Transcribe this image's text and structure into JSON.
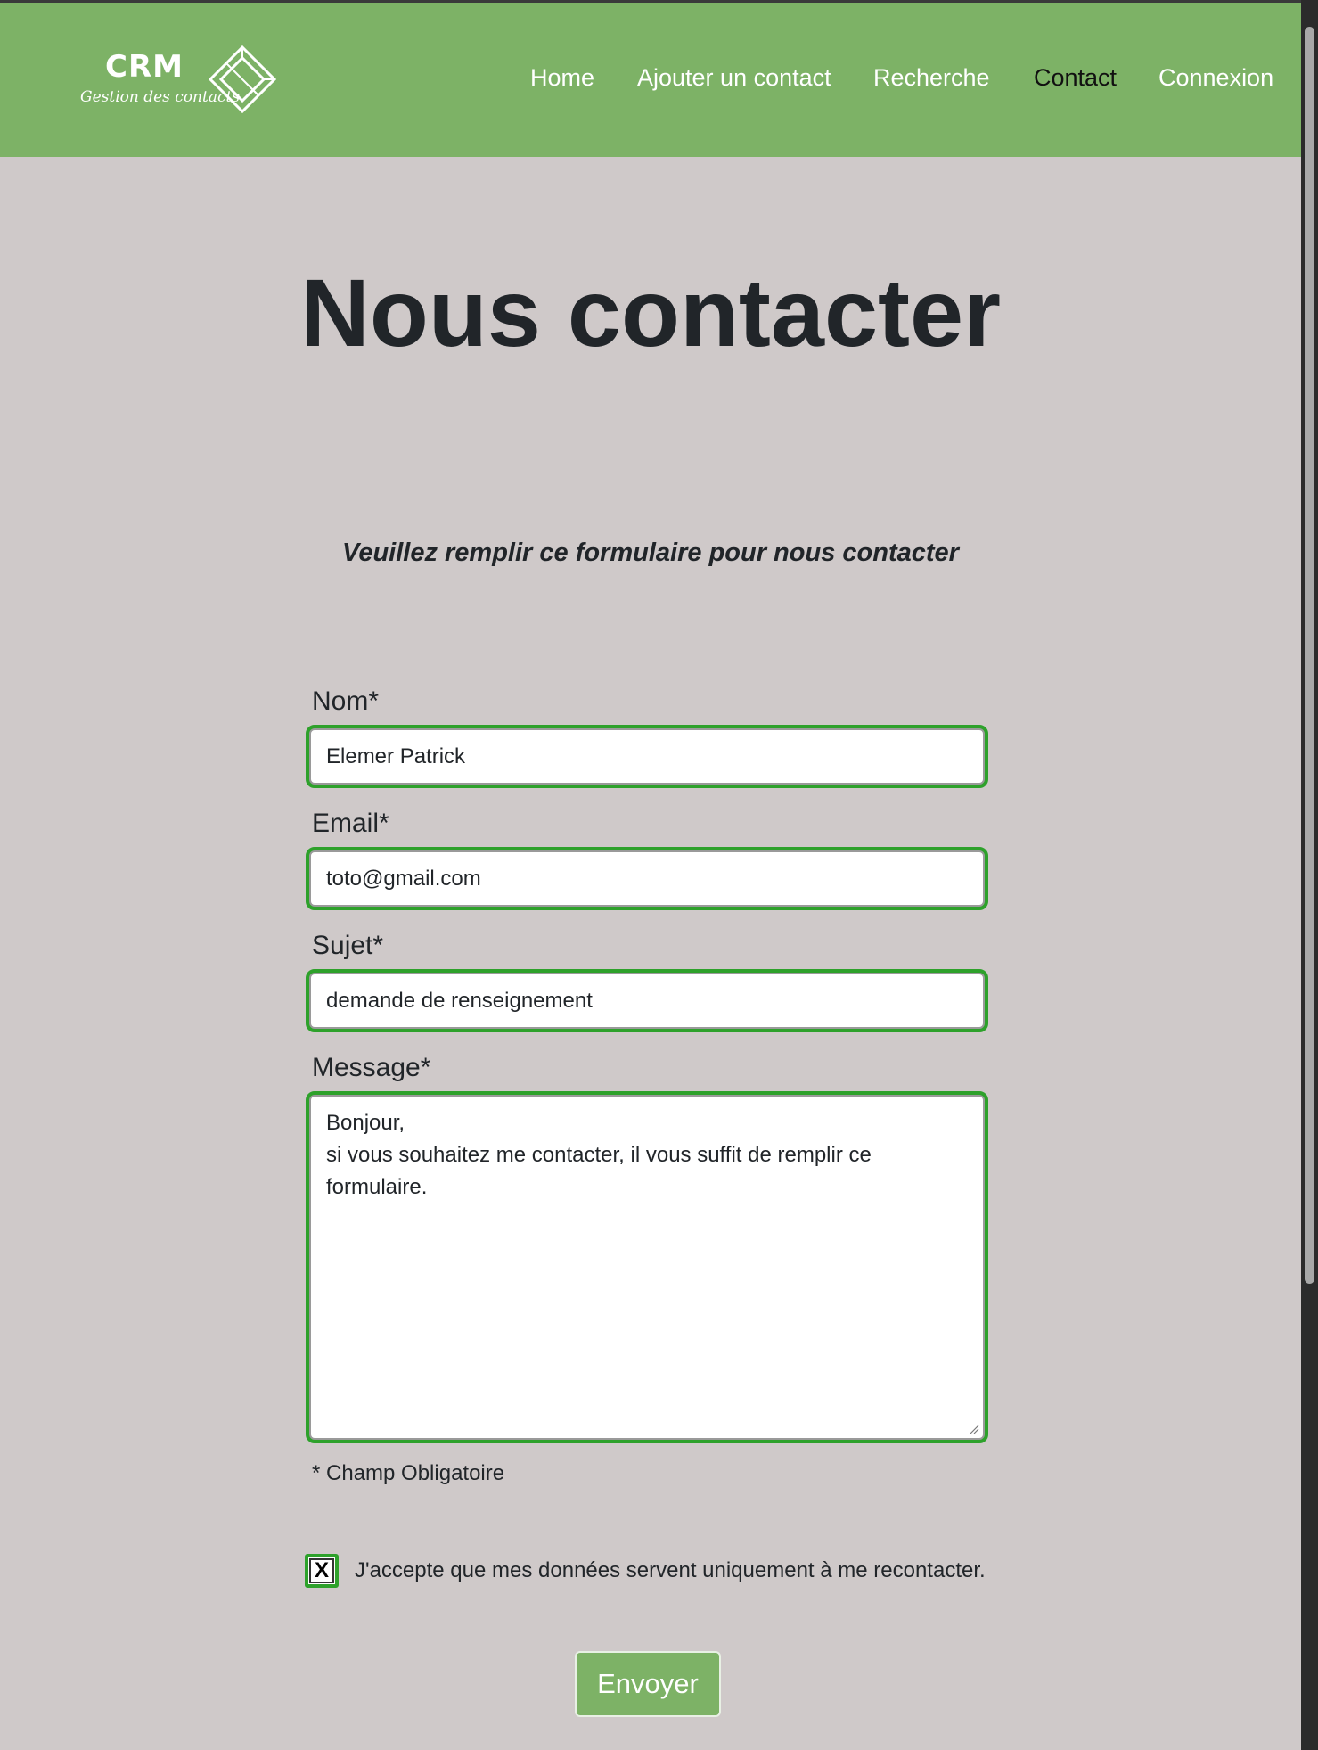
{
  "logo": {
    "title": "CRM",
    "subtitle": "Gestion des contacts"
  },
  "nav": {
    "items": [
      {
        "label": "Home"
      },
      {
        "label": "Ajouter un contact"
      },
      {
        "label": "Recherche"
      },
      {
        "label": "Contact",
        "active": true
      },
      {
        "label": "Connexion"
      }
    ]
  },
  "page": {
    "title": "Nous contacter",
    "subtitle": "Veuillez remplir ce formulaire pour nous contacter"
  },
  "form": {
    "nom": {
      "label": "Nom*",
      "value": "Elemer Patrick"
    },
    "email": {
      "label": "Email*",
      "value": "toto@gmail.com"
    },
    "sujet": {
      "label": "Sujet*",
      "value": "demande de renseignement"
    },
    "message": {
      "label": "Message*",
      "value": "Bonjour,\nsi vous souhaitez me contacter, il vous suffit de remplir ce formulaire."
    },
    "required_note": "* Champ Obligatoire",
    "consent": {
      "checked": true,
      "mark": "X",
      "label": "J'accepte que mes données servent uniquement à me recontacter."
    },
    "submit_label": "Envoyer"
  },
  "colors": {
    "navbar": "#7db266",
    "background": "#cfc9c9",
    "field_border": "#2ea12b",
    "active_nav": "#111111"
  }
}
